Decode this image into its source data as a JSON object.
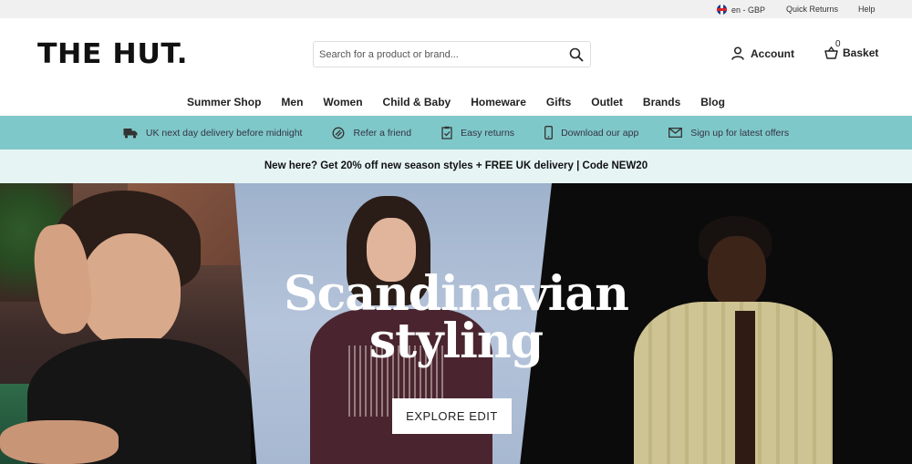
{
  "utility": {
    "locale": "en - GBP",
    "quick_returns": "Quick Returns",
    "help": "Help"
  },
  "header": {
    "logo": "THE HUT.",
    "search_placeholder": "Search for a product or brand...",
    "account_label": "Account",
    "basket_label": "Basket",
    "basket_count": "0"
  },
  "nav": {
    "items": [
      "Summer Shop",
      "Men",
      "Women",
      "Child & Baby",
      "Homeware",
      "Gifts",
      "Outlet",
      "Brands",
      "Blog"
    ]
  },
  "benefits": {
    "items": [
      {
        "label": "UK next day delivery before midnight",
        "icon": "truck-icon"
      },
      {
        "label": "Refer a friend",
        "icon": "tag-icon"
      },
      {
        "label": "Easy returns",
        "icon": "clipboard-check-icon"
      },
      {
        "label": "Download our app",
        "icon": "mobile-phone-icon"
      },
      {
        "label": "Sign up for latest offers",
        "icon": "envelope-icon"
      }
    ]
  },
  "promo": {
    "text": "New here? Get 20% off new season styles + FREE UK delivery | Code NEW20"
  },
  "hero": {
    "title_line1": "Scandinavian",
    "title_line2": "styling",
    "cta": "EXPLORE EDIT"
  },
  "colors": {
    "benefits_bg": "#7fc8c9",
    "promo_bg": "#e6f5f4",
    "utility_bg": "#f0f0f0"
  }
}
